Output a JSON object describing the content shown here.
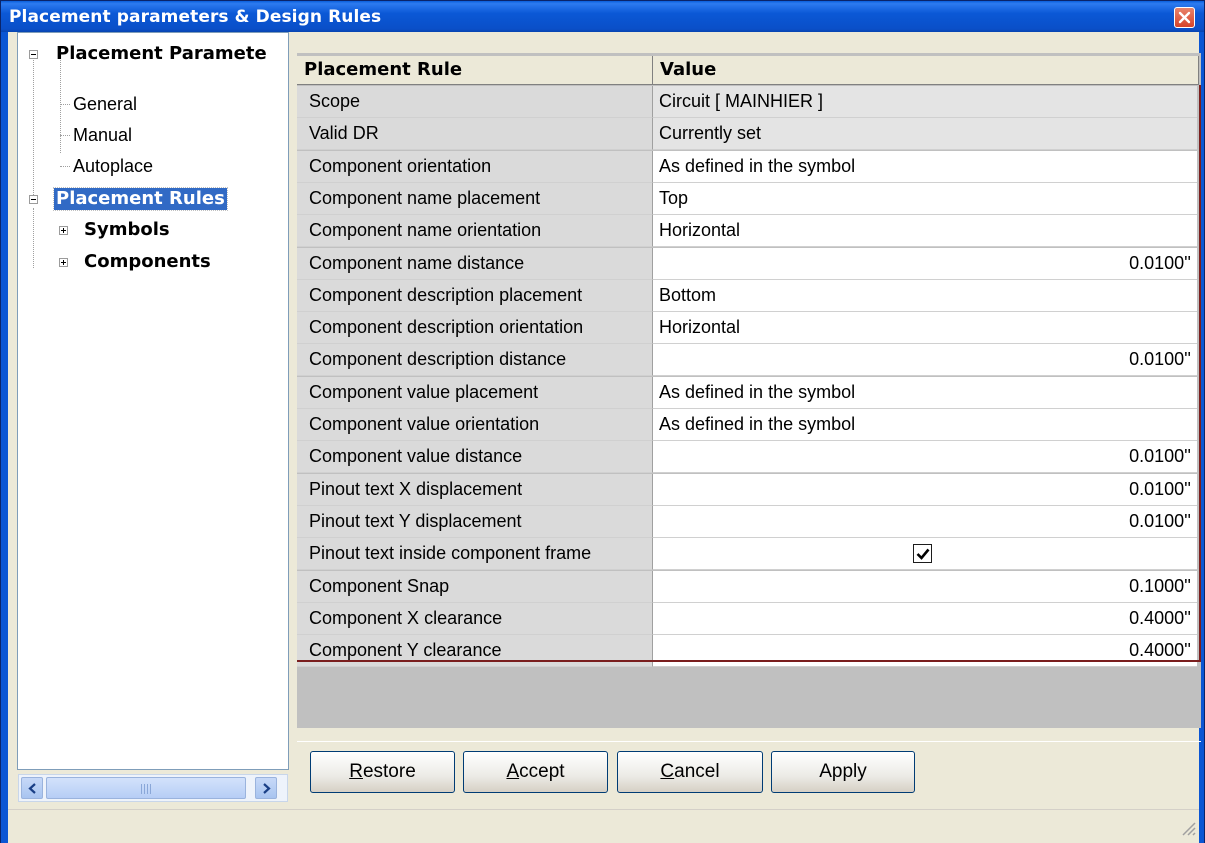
{
  "window": {
    "title": "Placement parameters & Design Rules"
  },
  "tree": {
    "nodes": [
      {
        "label": "Placement Paramete",
        "style": "bold"
      },
      {
        "label": "General",
        "style": "plain"
      },
      {
        "label": "Manual",
        "style": "plain"
      },
      {
        "label": "Autoplace",
        "style": "plain"
      },
      {
        "label": "Placement Rules",
        "style": "bold-selected"
      },
      {
        "label": "Symbols",
        "style": "bold"
      },
      {
        "label": "Components",
        "style": "bold"
      }
    ],
    "scrollbar_glyph": "III"
  },
  "grid": {
    "columns": [
      "Placement Rule",
      "Value"
    ],
    "rows": [
      {
        "name": "Scope",
        "value": "Circuit [ MAINHIER ]",
        "align": "left",
        "shaded": true
      },
      {
        "name": "Valid DR",
        "value": "Currently set",
        "align": "left",
        "shaded": true
      },
      {
        "name": "Component orientation",
        "value": "As defined in the symbol",
        "align": "left"
      },
      {
        "name": "Component name placement",
        "value": "Top",
        "align": "left"
      },
      {
        "name": "Component name orientation",
        "value": "Horizontal",
        "align": "left"
      },
      {
        "name": "Component name distance",
        "value": "0.0100''",
        "align": "right"
      },
      {
        "name": "Component description placement",
        "value": "Bottom",
        "align": "left"
      },
      {
        "name": "Component description orientation",
        "value": "Horizontal",
        "align": "left"
      },
      {
        "name": "Component description distance",
        "value": "0.0100''",
        "align": "right"
      },
      {
        "name": "Component value placement",
        "value": "As defined in the symbol",
        "align": "left"
      },
      {
        "name": "Component value orientation",
        "value": "As defined in the symbol",
        "align": "left"
      },
      {
        "name": "Component value distance",
        "value": "0.0100''",
        "align": "right"
      },
      {
        "name": "Pinout text X displacement",
        "value": "0.0100''",
        "align": "right"
      },
      {
        "name": "Pinout text Y displacement",
        "value": "0.0100''",
        "align": "right"
      },
      {
        "name": "Pinout text inside component frame",
        "value": "",
        "checkbox": true,
        "checked": true
      },
      {
        "name": "Component Snap",
        "value": "0.1000''",
        "align": "right"
      },
      {
        "name": "Component X clearance",
        "value": "0.4000''",
        "align": "right"
      },
      {
        "name": "Component Y clearance",
        "value": "0.4000''",
        "align": "right"
      }
    ]
  },
  "buttons": {
    "restore": {
      "mnemonic": "R",
      "rest": "estore"
    },
    "accept": {
      "mnemonic": "A",
      "rest": "ccept"
    },
    "cancel": {
      "mnemonic": "C",
      "rest": "ancel"
    },
    "apply": {
      "label": "Apply"
    }
  },
  "colors": {
    "titlebar": "#0b58d6",
    "selection": "#316ac5",
    "grid_border": "#7a1e1e"
  }
}
